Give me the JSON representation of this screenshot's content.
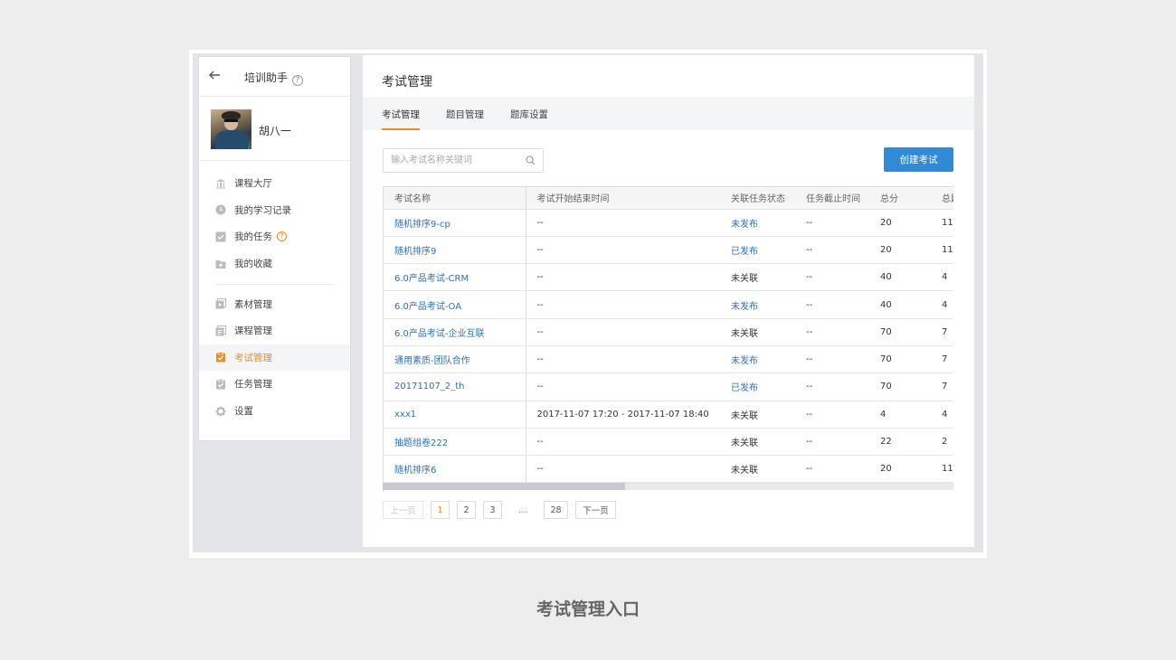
{
  "sidebar": {
    "app_title": "培训助手",
    "help_symbol": "?",
    "user_name": "胡八一",
    "menu_group1": [
      {
        "label": "课程大厅",
        "icon": "bank-icon"
      },
      {
        "label": "我的学习记录",
        "icon": "clock-icon"
      },
      {
        "label": "我的任务",
        "icon": "task-check-icon",
        "help": "?"
      },
      {
        "label": "我的收藏",
        "icon": "folder-star-icon"
      }
    ],
    "menu_group2": [
      {
        "label": "素材管理",
        "icon": "media-icon"
      },
      {
        "label": "课程管理",
        "icon": "course-icon"
      },
      {
        "label": "考试管理",
        "icon": "exam-clipboard-icon",
        "active": true
      },
      {
        "label": "任务管理",
        "icon": "task-clipboard-icon"
      },
      {
        "label": "设置",
        "icon": "gear-icon"
      }
    ]
  },
  "main": {
    "page_title": "考试管理",
    "tabs": [
      "考试管理",
      "题目管理",
      "题库设置"
    ],
    "search_placeholder": "输入考试名称关键词",
    "create_button": "创建考试",
    "table": {
      "headers": [
        "考试名称",
        "考试开始结束时间",
        "关联任务状态",
        "任务截止时间",
        "总分",
        "总题"
      ],
      "rows": [
        [
          "随机排序9-cp",
          "--",
          "未发布",
          "--",
          "20",
          "11"
        ],
        [
          "随机排序9",
          "--",
          "已发布",
          "--",
          "20",
          "11"
        ],
        [
          "6.0产品考试-CRM",
          "--",
          "未关联",
          "--",
          "40",
          "4"
        ],
        [
          "6.0产品考试-OA",
          "--",
          "未发布",
          "--",
          "40",
          "4"
        ],
        [
          "6.0产品考试-企业互联",
          "--",
          "未关联",
          "--",
          "70",
          "7"
        ],
        [
          "通用素质-团队合作",
          "--",
          "未发布",
          "--",
          "70",
          "7"
        ],
        [
          "20171107_2_th",
          "--",
          "已发布",
          "--",
          "70",
          "7"
        ],
        [
          "xxx1",
          "2017-11-07 17:20 - 2017-11-07 18:40",
          "未关联",
          "--",
          "4",
          "4"
        ],
        [
          "抽题组卷222",
          "--",
          "未关联",
          "--",
          "22",
          "2"
        ],
        [
          "随机排序6",
          "--",
          "未关联",
          "--",
          "20",
          "11"
        ]
      ]
    },
    "pagination": {
      "prev": "上一页",
      "pages": [
        "1",
        "2",
        "3"
      ],
      "ellipsis": "...",
      "last": "28",
      "next": "下一页",
      "current": "1"
    }
  },
  "caption": "考试管理入口",
  "colors": {
    "accent": "#f08a24",
    "primary": "#2f8ad8",
    "link": "#2f6fb5"
  }
}
